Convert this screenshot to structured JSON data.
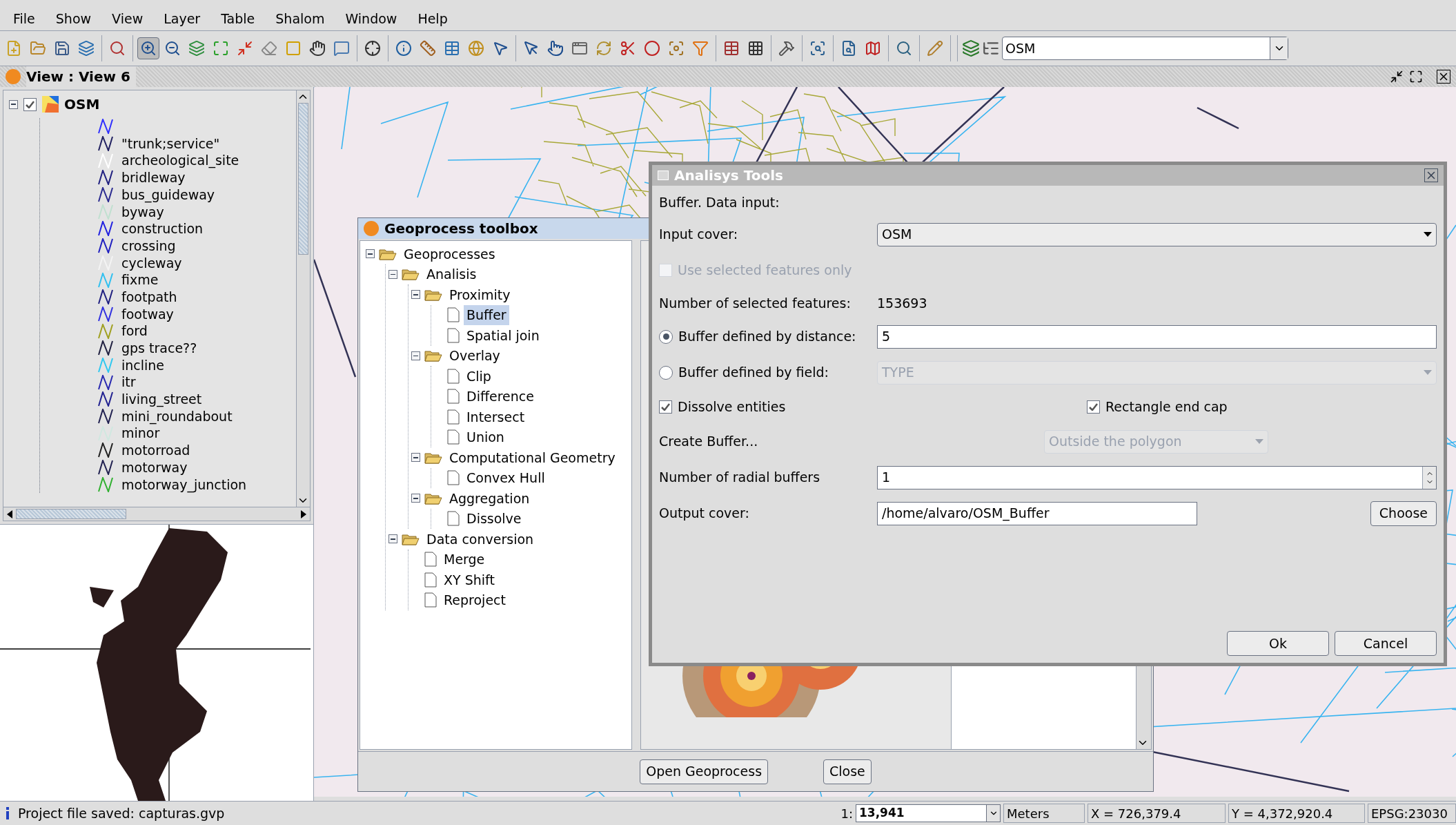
{
  "menu": [
    "File",
    "Show",
    "View",
    "Layer",
    "Table",
    "Shalom",
    "Window",
    "Help"
  ],
  "toolbar": {
    "tools": [
      {
        "pressed": false
      },
      {
        "pressed": false
      },
      {
        "pressed": false
      },
      {
        "pressed": false
      },
      {
        "pressed": false
      },
      {
        "pressed": true
      },
      {
        "pressed": false
      },
      {
        "pressed": false
      },
      {
        "pressed": false
      },
      {
        "pressed": false
      },
      {
        "pressed": false
      },
      {
        "pressed": false
      },
      {
        "pressed": false
      },
      {
        "pressed": false
      },
      {
        "pressed": false
      },
      {
        "pressed": false
      },
      {
        "pressed": false
      },
      {
        "pressed": false
      },
      {
        "pressed": false
      },
      {
        "pressed": false
      },
      {
        "pressed": false
      },
      {
        "pressed": false
      },
      {
        "pressed": false
      },
      {
        "pressed": false
      },
      {
        "pressed": false
      },
      {
        "pressed": false
      },
      {
        "pressed": false
      },
      {
        "pressed": false
      },
      {
        "pressed": false
      },
      {
        "pressed": false
      },
      {
        "pressed": false
      },
      {
        "pressed": false
      },
      {
        "pressed": false
      },
      {
        "pressed": false
      },
      {
        "pressed": false
      },
      {
        "pressed": false
      }
    ],
    "layer_combo": "OSM"
  },
  "view": {
    "title": "View : View 6"
  },
  "toc": {
    "layer": {
      "name": "OSM",
      "checked": true,
      "expanded": true
    },
    "items": [
      {
        "color": "#3030ff"
      },
      {
        "label": "\"trunk;service\"",
        "color": "#202060"
      },
      {
        "label": "archeological_site",
        "color": "#ffffff"
      },
      {
        "label": "bridleway",
        "color": "#202080"
      },
      {
        "label": "bus_guideway",
        "color": "#2a2a90"
      },
      {
        "label": "byway",
        "color": "#c0e0d0"
      },
      {
        "label": "construction",
        "color": "#2020e0"
      },
      {
        "label": "crossing",
        "color": "#2020c0"
      },
      {
        "label": "cycleway",
        "color": "#f4f4f4"
      },
      {
        "label": "fixme",
        "color": "#30c0f0"
      },
      {
        "label": "footpath",
        "color": "#202080"
      },
      {
        "label": "footway",
        "color": "#3030e0"
      },
      {
        "label": "ford",
        "color": "#a0a020"
      },
      {
        "label": "gps trace??",
        "color": "#202040"
      },
      {
        "label": "incline",
        "color": "#30c8f0"
      },
      {
        "label": "itr",
        "color": "#2828b0"
      },
      {
        "label": "living_street",
        "color": "#202090"
      },
      {
        "label": "mini_roundabout",
        "color": "#202050"
      },
      {
        "label": "minor",
        "color": "#d0e8e0"
      },
      {
        "label": "motorroad",
        "color": "#202020"
      },
      {
        "label": "motorway",
        "color": "#202050"
      },
      {
        "label": "motorway_junction",
        "color": "#30b030"
      }
    ]
  },
  "toolbox": {
    "title": "Geoprocess toolbox",
    "tree": [
      {
        "label": "Geoprocesses",
        "expanded": true,
        "selected": false,
        "children": [
          {
            "label": "Analisis",
            "expanded": true,
            "selected": false,
            "children": [
              {
                "label": "Proximity",
                "expanded": true,
                "selected": false,
                "children": [
                  {
                    "label": "Buffer",
                    "selected": true
                  },
                  {
                    "label": "Spatial join",
                    "selected": false
                  }
                ]
              },
              {
                "label": "Overlay",
                "expanded": true,
                "selected": false,
                "children": [
                  {
                    "label": "Clip",
                    "selected": false
                  },
                  {
                    "label": "Difference",
                    "selected": false
                  },
                  {
                    "label": "Intersect",
                    "selected": false
                  },
                  {
                    "label": "Union",
                    "selected": false
                  }
                ]
              },
              {
                "label": "Computational Geometry",
                "expanded": true,
                "selected": false,
                "children": [
                  {
                    "label": "Convex Hull",
                    "selected": false
                  }
                ]
              },
              {
                "label": "Aggregation",
                "expanded": true,
                "selected": false,
                "children": [
                  {
                    "label": "Dissolve",
                    "selected": false
                  }
                ]
              }
            ]
          },
          {
            "label": "Data conversion",
            "expanded": true,
            "selected": false,
            "children": [
              {
                "label": "Merge",
                "selected": false
              },
              {
                "label": "XY Shift",
                "selected": false
              },
              {
                "label": "Reproject",
                "selected": false
              }
            ]
          }
        ]
      }
    ],
    "buttons": [
      "Open Geoprocess",
      "Close"
    ]
  },
  "dialog": {
    "title": "Analisys Tools",
    "heading": "Buffer. Data input:",
    "rows": [
      {
        "kind": "select",
        "label": "Input cover:",
        "value": "OSM"
      },
      {
        "kind": "checkbox",
        "label": "Use selected features only",
        "checked": false,
        "disabled": true
      },
      {
        "kind": "info",
        "label": "Number of selected features:",
        "value": "153693"
      },
      {
        "kind": "radio_text",
        "label": "Buffer defined by distance:",
        "selected": true,
        "value": "5"
      },
      {
        "kind": "radio_select",
        "label": "Buffer defined by field:",
        "selected": false,
        "value": "TYPE",
        "disabled": true
      },
      {
        "kind": "checks",
        "items": [
          {
            "label": "Dissolve entities",
            "checked": true
          },
          {
            "label": "Rectangle end cap",
            "checked": true
          }
        ]
      },
      {
        "kind": "select_mid",
        "label": "Create Buffer...",
        "value": "Outside the polygon",
        "disabled": true
      },
      {
        "kind": "spinner",
        "label": "Number of radial buffers",
        "value": "1"
      },
      {
        "kind": "file",
        "label": "Output cover:",
        "value": "/home/alvaro/OSM_Buffer",
        "button": "Choose"
      }
    ],
    "buttons": [
      "Ok",
      "Cancel"
    ]
  },
  "status": {
    "message": "Project file saved: capturas.gvp",
    "scale_prefix": "1:",
    "scale": "13,941",
    "units": "Meters",
    "x": "X = 726,379.4",
    "y": "Y = 4,372,920.4",
    "crs": "EPSG:23030"
  }
}
